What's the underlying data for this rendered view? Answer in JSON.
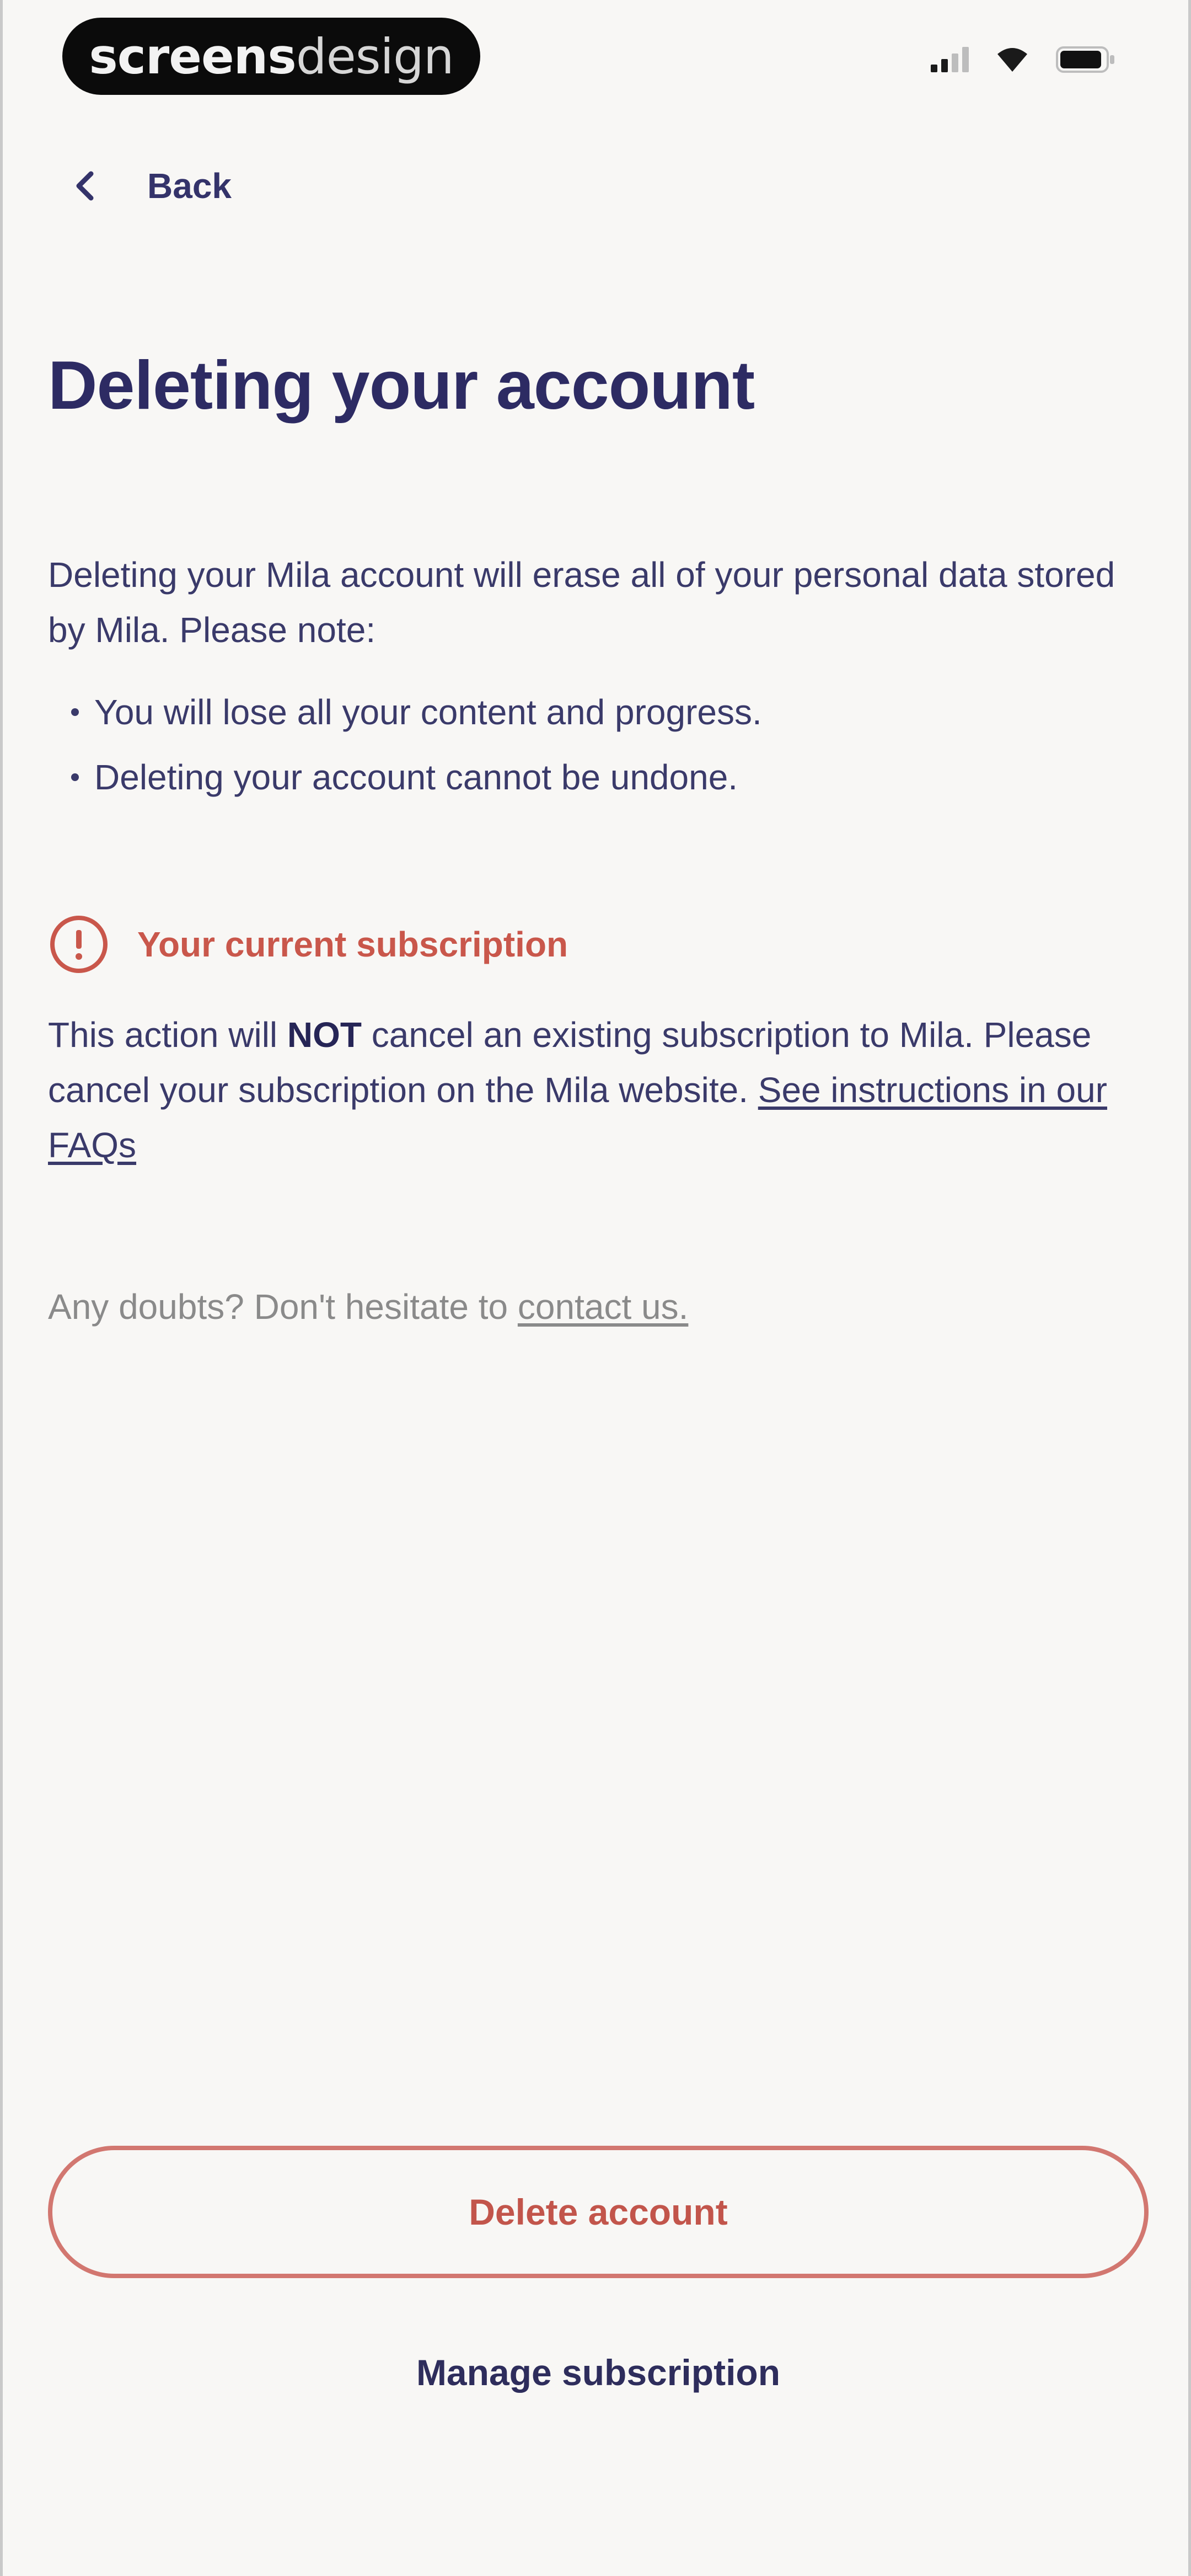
{
  "status_bar": {
    "carrier_bold": "screens",
    "carrier_light": "design",
    "icons": [
      "signal-icon",
      "wifi-icon",
      "battery-icon"
    ]
  },
  "nav": {
    "back_label": "Back",
    "back_icon": "chevron-left-icon"
  },
  "page": {
    "title": "Deleting your account",
    "intro": "Deleting your Mila account will erase all of your personal data stored by Mila. Please note:",
    "bullets": [
      "You will lose all your content and progress.",
      "Deleting your account cannot be undone."
    ]
  },
  "warning": {
    "icon": "alert-circle-icon",
    "heading": "Your current subscription",
    "text_before": "This action will ",
    "text_emphasis": "NOT",
    "text_after": " cancel an existing subscription to Mila. Please cancel your subscription on the Mila website. ",
    "link_label": "See instructions in our FAQs"
  },
  "help": {
    "text": "Any doubts? Don't hesitate to ",
    "link_label": "contact us."
  },
  "actions": {
    "delete_label": "Delete account",
    "manage_label": "Manage subscription"
  },
  "colors": {
    "background": "#f8f7f5",
    "primary_text": "#2d2b63",
    "warning": "#c9574b",
    "button_border": "#d27770",
    "muted": "#8a8a8a"
  }
}
